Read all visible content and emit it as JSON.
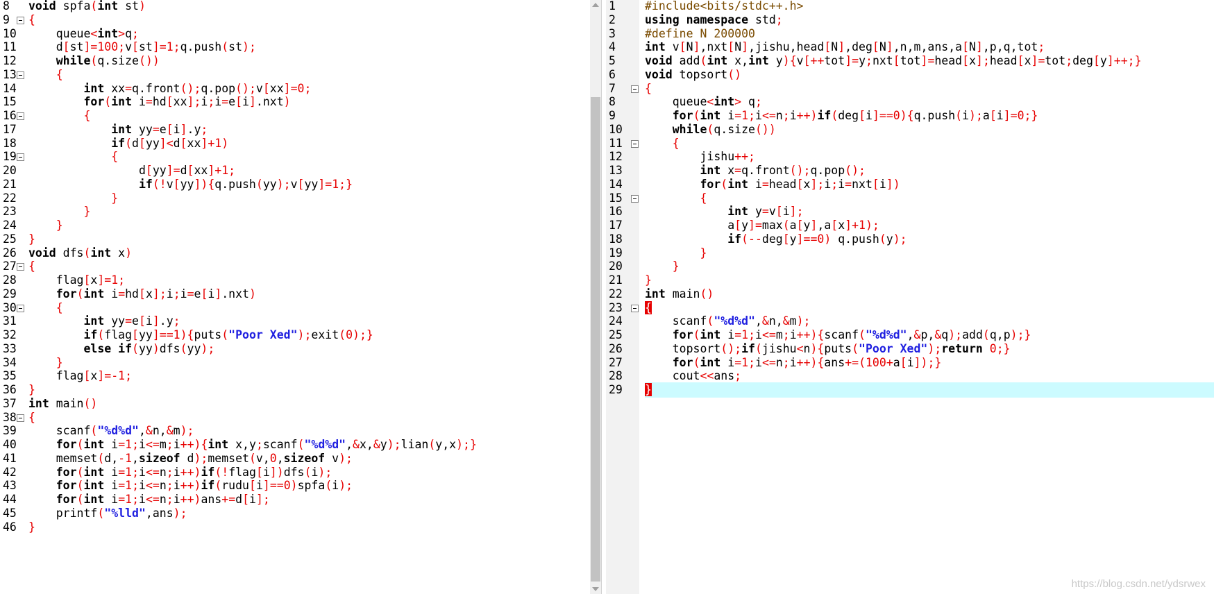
{
  "left_editor": {
    "lines": [
      {
        "n": "8",
        "t": "void spfa(int st)"
      },
      {
        "n": "9",
        "t": "{"
      },
      {
        "n": "10",
        "t": "    queue<int>q;"
      },
      {
        "n": "11",
        "t": "    d[st]=100;v[st]=1;q.push(st);"
      },
      {
        "n": "12",
        "t": "    while(q.size())"
      },
      {
        "n": "13",
        "t": "    {"
      },
      {
        "n": "14",
        "t": "        int xx=q.front();q.pop();v[xx]=0;"
      },
      {
        "n": "15",
        "t": "        for(int i=hd[xx];i;i=e[i].nxt)"
      },
      {
        "n": "16",
        "t": "        {"
      },
      {
        "n": "17",
        "t": "            int yy=e[i].y;"
      },
      {
        "n": "18",
        "t": "            if(d[yy]<d[xx]+1)"
      },
      {
        "n": "19",
        "t": "            {"
      },
      {
        "n": "20",
        "t": "                d[yy]=d[xx]+1;"
      },
      {
        "n": "21",
        "t": "                if(!v[yy]){q.push(yy);v[yy]=1;}"
      },
      {
        "n": "22",
        "t": "            }"
      },
      {
        "n": "23",
        "t": "        }"
      },
      {
        "n": "24",
        "t": "    }"
      },
      {
        "n": "25",
        "t": "}"
      },
      {
        "n": "26",
        "t": "void dfs(int x)"
      },
      {
        "n": "27",
        "t": "{"
      },
      {
        "n": "28",
        "t": "    flag[x]=1;"
      },
      {
        "n": "29",
        "t": "    for(int i=hd[x];i;i=e[i].nxt)"
      },
      {
        "n": "30",
        "t": "    {"
      },
      {
        "n": "31",
        "t": "        int yy=e[i].y;"
      },
      {
        "n": "32",
        "t": "        if(flag[yy]==1){puts(\"Poor Xed\");exit(0);}"
      },
      {
        "n": "33",
        "t": "        else if(yy)dfs(yy);"
      },
      {
        "n": "34",
        "t": "    }"
      },
      {
        "n": "35",
        "t": "    flag[x]=-1;"
      },
      {
        "n": "36",
        "t": "}"
      },
      {
        "n": "37",
        "t": "int main()"
      },
      {
        "n": "38",
        "t": "{"
      },
      {
        "n": "39",
        "t": "    scanf(\"%d%d\",&n,&m);"
      },
      {
        "n": "40",
        "t": "    for(int i=1;i<=m;i++){int x,y;scanf(\"%d%d\",&x,&y);lian(y,x);}"
      },
      {
        "n": "41",
        "t": "    memset(d,-1,sizeof d);memset(v,0,sizeof v);"
      },
      {
        "n": "42",
        "t": "    for(int i=1;i<=n;i++)if(!flag[i])dfs(i);"
      },
      {
        "n": "43",
        "t": "    for(int i=1;i<=n;i++)if(rudu[i]==0)spfa(i);"
      },
      {
        "n": "44",
        "t": "    for(int i=1;i<=n;i++)ans+=d[i];"
      },
      {
        "n": "45",
        "t": "    printf(\"%lld\",ans);"
      },
      {
        "n": "46",
        "t": "}"
      }
    ]
  },
  "right_editor": {
    "lines": [
      {
        "n": "1",
        "t": "#include<bits/stdc++.h>"
      },
      {
        "n": "2",
        "t": "using namespace std;"
      },
      {
        "n": "3",
        "t": "#define N 200000"
      },
      {
        "n": "4",
        "t": "int v[N],nxt[N],jishu,head[N],deg[N],n,m,ans,a[N],p,q,tot;"
      },
      {
        "n": "5",
        "t": "void add(int x,int y){v[++tot]=y;nxt[tot]=head[x];head[x]=tot;deg[y]++;}"
      },
      {
        "n": "6",
        "t": "void topsort()"
      },
      {
        "n": "7",
        "t": "{"
      },
      {
        "n": "8",
        "t": "    queue<int> q;"
      },
      {
        "n": "9",
        "t": "    for(int i=1;i<=n;i++)if(deg[i]==0){q.push(i);a[i]=0;}"
      },
      {
        "n": "10",
        "t": "    while(q.size())"
      },
      {
        "n": "11",
        "t": "    {"
      },
      {
        "n": "12",
        "t": "        jishu++;"
      },
      {
        "n": "13",
        "t": "        int x=q.front();q.pop();"
      },
      {
        "n": "14",
        "t": "        for(int i=head[x];i;i=nxt[i])"
      },
      {
        "n": "15",
        "t": "        {"
      },
      {
        "n": "16",
        "t": "            int y=v[i];"
      },
      {
        "n": "17",
        "t": "            a[y]=max(a[y],a[x]+1);"
      },
      {
        "n": "18",
        "t": "            if(--deg[y]==0) q.push(y);"
      },
      {
        "n": "19",
        "t": "        }"
      },
      {
        "n": "20",
        "t": "    }"
      },
      {
        "n": "21",
        "t": "}"
      },
      {
        "n": "22",
        "t": "int main()"
      },
      {
        "n": "23",
        "t": "{"
      },
      {
        "n": "24",
        "t": "    scanf(\"%d%d\",&n,&m);"
      },
      {
        "n": "25",
        "t": "    for(int i=1;i<=m;i++){scanf(\"%d%d\",&p,&q);add(q,p);}"
      },
      {
        "n": "26",
        "t": "    topsort();if(jishu<n){puts(\"Poor Xed\");return 0;}"
      },
      {
        "n": "27",
        "t": "    for(int i=1;i<=n;i++){ans+=(100+a[i]);}"
      },
      {
        "n": "28",
        "t": "    cout<<ans;"
      },
      {
        "n": "29",
        "t": "}"
      }
    ]
  },
  "watermark": "https://blog.csdn.net/ydsrwex",
  "colors": {
    "operator": "#e60000",
    "string": "#1f1fe0",
    "current_line": "#ccfbff",
    "matched_brace": "#e60000"
  }
}
